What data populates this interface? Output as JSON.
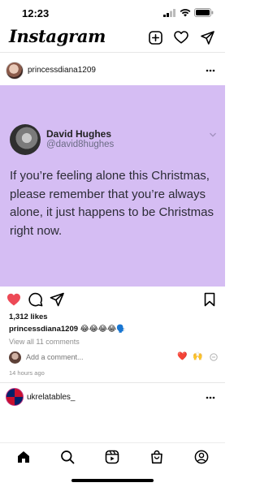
{
  "status_bar": {
    "time": "12:23",
    "icons": [
      "cellular-icon",
      "wifi-icon",
      "battery-icon"
    ]
  },
  "header": {
    "logo_text": "Instagram",
    "actions": [
      "new-post-icon",
      "heart-icon",
      "direct-message-icon"
    ]
  },
  "post": {
    "username": "princessdiana1209",
    "tweet": {
      "name": "David Hughes",
      "handle": "@david8hughes",
      "text": "If you’re feeling alone this Christmas, please remember that you’re always alone, it just happens to be Christmas right now."
    },
    "likes": "1,312 likes",
    "caption_user": "princessdiana1209",
    "caption_emojis": "😂😂😂😂🗣️",
    "view_comments": "View all 11 comments",
    "comment_placeholder": "Add a comment...",
    "quick_reactions": [
      "❤️",
      "🙌"
    ],
    "timestamp": "14 hours ago",
    "liked": true
  },
  "next_post": {
    "username": "ukrelatables_"
  },
  "bottom_nav": [
    "home-icon",
    "search-icon",
    "reels-icon",
    "shop-icon",
    "profile-icon"
  ],
  "colors": {
    "post_background": "#d5bdf3",
    "like_red": "#ed4956"
  }
}
